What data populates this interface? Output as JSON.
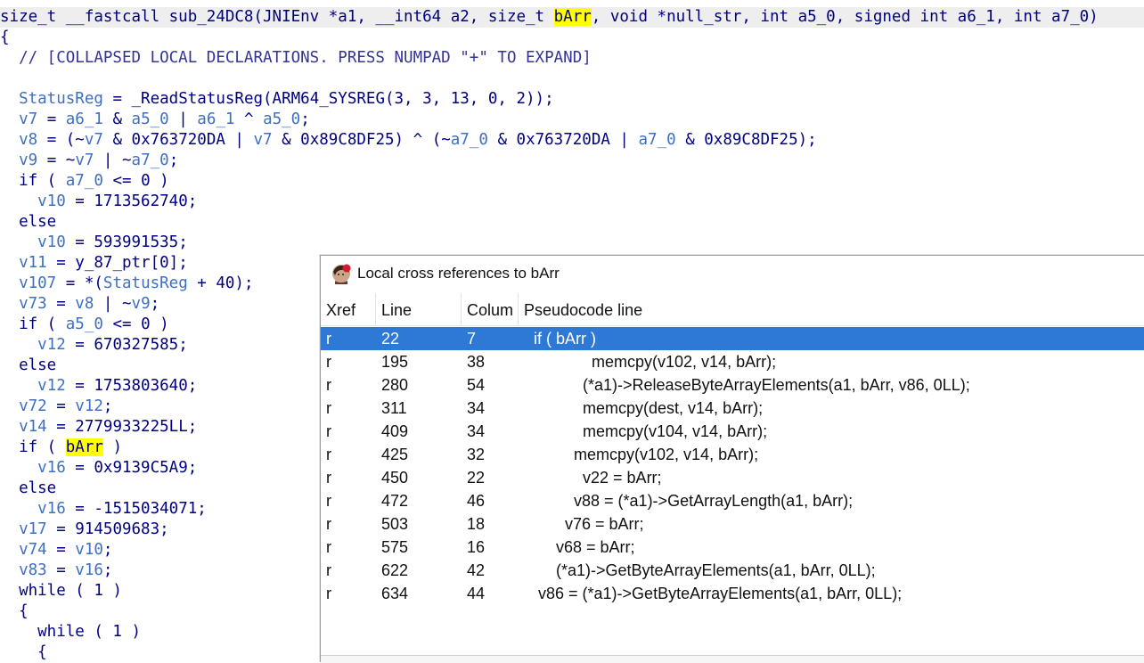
{
  "editor": {
    "signature": {
      "pre": "size_t __fastcall sub_24DC8(JNIEnv *a1, __int64 a2, size_t ",
      "highlight": "bArr",
      "post": ", void *null_str, int a5_0, signed int a6_1, int a7_0)"
    },
    "lines": [
      {
        "parts": [
          {
            "t": "{"
          }
        ]
      },
      {
        "parts": [
          {
            "t": "  // [COLLAPSED LOCAL DECLARATIONS. PRESS NUMPAD \"+\" TO EXPAND]",
            "k": "c"
          }
        ]
      },
      {
        "parts": [
          {
            "t": ""
          }
        ]
      },
      {
        "parts": [
          {
            "t": "  "
          },
          {
            "t": "StatusReg",
            "k": "v"
          },
          {
            "t": " = _ReadStatusReg(ARM64_SYSREG(3, 3, 13, 0, 2));"
          }
        ]
      },
      {
        "parts": [
          {
            "t": "  "
          },
          {
            "t": "v7",
            "k": "v"
          },
          {
            "t": " = "
          },
          {
            "t": "a6_1",
            "k": "v"
          },
          {
            "t": " & "
          },
          {
            "t": "a5_0",
            "k": "v"
          },
          {
            "t": " | "
          },
          {
            "t": "a6_1",
            "k": "v"
          },
          {
            "t": " ^ "
          },
          {
            "t": "a5_0",
            "k": "v"
          },
          {
            "t": ";"
          }
        ]
      },
      {
        "parts": [
          {
            "t": "  "
          },
          {
            "t": "v8",
            "k": "v"
          },
          {
            "t": " = (~"
          },
          {
            "t": "v7",
            "k": "v"
          },
          {
            "t": " & 0x763720DA | "
          },
          {
            "t": "v7",
            "k": "v"
          },
          {
            "t": " & 0x89C8DF25) ^ (~"
          },
          {
            "t": "a7_0",
            "k": "v"
          },
          {
            "t": " & 0x763720DA | "
          },
          {
            "t": "a7_0",
            "k": "v"
          },
          {
            "t": " & 0x89C8DF25);"
          }
        ]
      },
      {
        "parts": [
          {
            "t": "  "
          },
          {
            "t": "v9",
            "k": "v"
          },
          {
            "t": " = ~"
          },
          {
            "t": "v7",
            "k": "v"
          },
          {
            "t": " | ~"
          },
          {
            "t": "a7_0",
            "k": "v"
          },
          {
            "t": ";"
          }
        ]
      },
      {
        "parts": [
          {
            "t": "  if ( "
          },
          {
            "t": "a7_0",
            "k": "v"
          },
          {
            "t": " <= 0 )"
          }
        ]
      },
      {
        "parts": [
          {
            "t": "    "
          },
          {
            "t": "v10",
            "k": "v"
          },
          {
            "t": " = 1713562740;"
          }
        ]
      },
      {
        "parts": [
          {
            "t": "  else"
          }
        ]
      },
      {
        "parts": [
          {
            "t": "    "
          },
          {
            "t": "v10",
            "k": "v"
          },
          {
            "t": " = 593991535;"
          }
        ]
      },
      {
        "parts": [
          {
            "t": "  "
          },
          {
            "t": "v11",
            "k": "v"
          },
          {
            "t": " = y_87_ptr[0];"
          }
        ]
      },
      {
        "parts": [
          {
            "t": "  "
          },
          {
            "t": "v107",
            "k": "v"
          },
          {
            "t": " = *("
          },
          {
            "t": "StatusReg",
            "k": "v"
          },
          {
            "t": " + 40);"
          }
        ]
      },
      {
        "parts": [
          {
            "t": "  "
          },
          {
            "t": "v73",
            "k": "v"
          },
          {
            "t": " = "
          },
          {
            "t": "v8",
            "k": "v"
          },
          {
            "t": " | ~"
          },
          {
            "t": "v9",
            "k": "v"
          },
          {
            "t": ";"
          }
        ]
      },
      {
        "parts": [
          {
            "t": "  if ( "
          },
          {
            "t": "a5_0",
            "k": "v"
          },
          {
            "t": " <= 0 )"
          }
        ]
      },
      {
        "parts": [
          {
            "t": "    "
          },
          {
            "t": "v12",
            "k": "v"
          },
          {
            "t": " = 670327585;"
          }
        ]
      },
      {
        "parts": [
          {
            "t": "  else"
          }
        ]
      },
      {
        "parts": [
          {
            "t": "    "
          },
          {
            "t": "v12",
            "k": "v"
          },
          {
            "t": " = 1753803640;"
          }
        ]
      },
      {
        "parts": [
          {
            "t": "  "
          },
          {
            "t": "v72",
            "k": "v"
          },
          {
            "t": " = "
          },
          {
            "t": "v12",
            "k": "v"
          },
          {
            "t": ";"
          }
        ]
      },
      {
        "parts": [
          {
            "t": "  "
          },
          {
            "t": "v14",
            "k": "v"
          },
          {
            "t": " = 2779933225LL;"
          }
        ]
      },
      {
        "parts": [
          {
            "t": "  if ( "
          },
          {
            "t": "bArr",
            "k": "h"
          },
          {
            "t": " )"
          }
        ]
      },
      {
        "parts": [
          {
            "t": "    "
          },
          {
            "t": "v16",
            "k": "v"
          },
          {
            "t": " = 0x9139C5A9;"
          }
        ]
      },
      {
        "parts": [
          {
            "t": "  else"
          }
        ]
      },
      {
        "parts": [
          {
            "t": "    "
          },
          {
            "t": "v16",
            "k": "v"
          },
          {
            "t": " = -1515034071;"
          }
        ]
      },
      {
        "parts": [
          {
            "t": "  "
          },
          {
            "t": "v17",
            "k": "v"
          },
          {
            "t": " = 914509683;"
          }
        ]
      },
      {
        "parts": [
          {
            "t": "  "
          },
          {
            "t": "v74",
            "k": "v"
          },
          {
            "t": " = "
          },
          {
            "t": "v10",
            "k": "v"
          },
          {
            "t": ";"
          }
        ]
      },
      {
        "parts": [
          {
            "t": "  "
          },
          {
            "t": "v83",
            "k": "v"
          },
          {
            "t": " = "
          },
          {
            "t": "v16",
            "k": "v"
          },
          {
            "t": ";"
          }
        ]
      },
      {
        "parts": [
          {
            "t": "  while ( 1 )"
          }
        ]
      },
      {
        "parts": [
          {
            "t": "  {"
          }
        ]
      },
      {
        "parts": [
          {
            "t": "    while ( 1 )"
          }
        ]
      },
      {
        "parts": [
          {
            "t": "    {"
          }
        ]
      }
    ]
  },
  "dialog": {
    "title": "Local cross references to bArr",
    "icon": "ida-app-icon",
    "columns": [
      "Xref",
      "Line",
      "Colum",
      "Pseudocode line"
    ],
    "rows": [
      {
        "xref": "r",
        "line": "22",
        "col": "7",
        "code": " if ( bArr )",
        "selected": true
      },
      {
        "xref": "r",
        "line": "195",
        "col": "38",
        "code": "              memcpy(v102, v14, bArr);"
      },
      {
        "xref": "r",
        "line": "280",
        "col": "54",
        "code": "            (*a1)->ReleaseByteArrayElements(a1, bArr, v86, 0LL);"
      },
      {
        "xref": "r",
        "line": "311",
        "col": "34",
        "code": "            memcpy(dest, v14, bArr);"
      },
      {
        "xref": "r",
        "line": "409",
        "col": "34",
        "code": "            memcpy(v104, v14, bArr);"
      },
      {
        "xref": "r",
        "line": "425",
        "col": "32",
        "code": "          memcpy(v102, v14, bArr);"
      },
      {
        "xref": "r",
        "line": "450",
        "col": "22",
        "code": "            v22 = bArr;"
      },
      {
        "xref": "r",
        "line": "472",
        "col": "46",
        "code": "          v88 = (*a1)->GetArrayLength(a1, bArr);"
      },
      {
        "xref": "r",
        "line": "503",
        "col": "18",
        "code": "        v76 = bArr;"
      },
      {
        "xref": "r",
        "line": "575",
        "col": "16",
        "code": "      v68 = bArr;"
      },
      {
        "xref": "r",
        "line": "622",
        "col": "42",
        "code": "      (*a1)->GetByteArrayElements(a1, bArr, 0LL);"
      },
      {
        "xref": "r",
        "line": "634",
        "col": "44",
        "code": "  v86 = (*a1)->GetByteArrayElements(a1, bArr, 0LL);"
      }
    ]
  },
  "colors": {
    "selection": "#2e78d6",
    "highlight": "#ffff00",
    "code_text": "#000080",
    "identifier": "#3e6fc1"
  }
}
